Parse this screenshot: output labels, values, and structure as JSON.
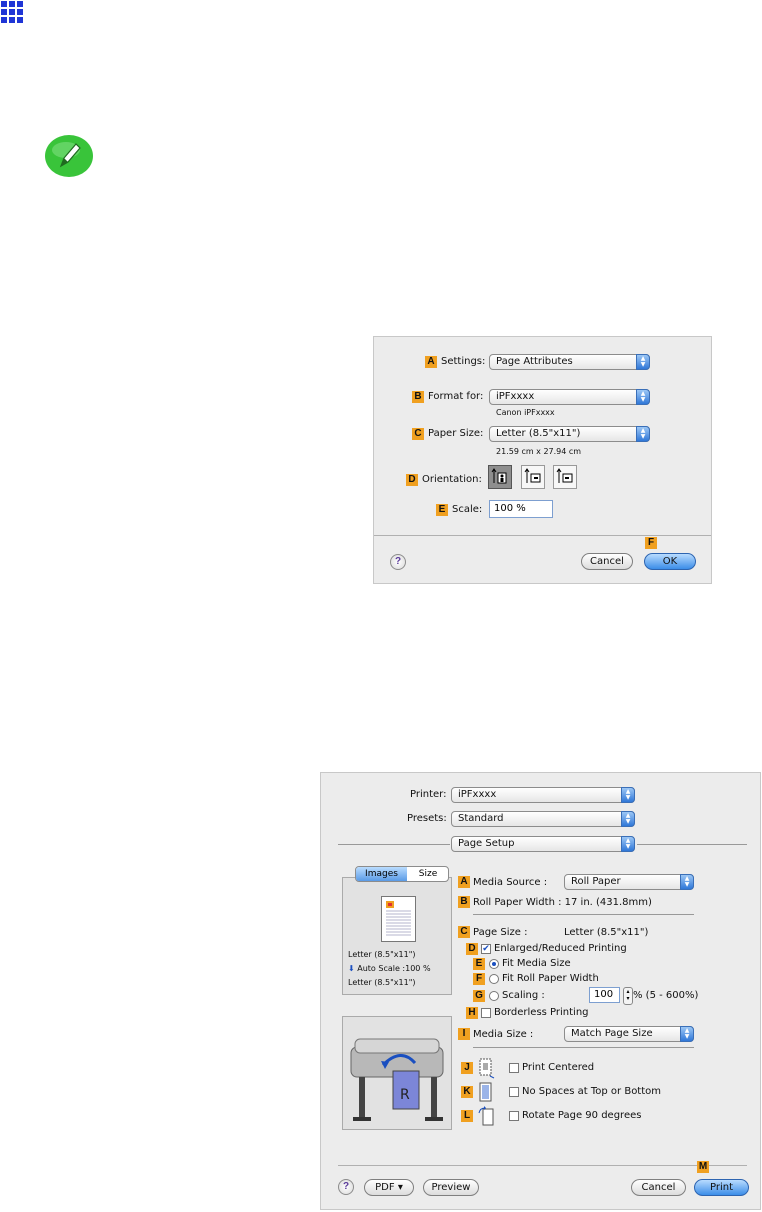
{
  "page_icon": "grid-icon",
  "note_icon": "pencil-note-icon",
  "page_setup_dialog": {
    "settings_label": "Settings:",
    "settings_value": "Page Attributes",
    "format_for_label": "Format for:",
    "format_for_value": "iPFxxxx",
    "format_for_sub": "Canon iPFxxxx",
    "paper_size_label": "Paper Size:",
    "paper_size_value": "Letter (8.5\"x11\")",
    "paper_size_sub": "21.59 cm x 27.94 cm",
    "orientation_label": "Orientation:",
    "scale_label": "Scale:",
    "scale_value": "100 %",
    "help": "?",
    "cancel": "Cancel",
    "ok": "OK",
    "badges": {
      "a": "A",
      "b": "B",
      "c": "C",
      "d": "D",
      "e": "E",
      "f": "F"
    }
  },
  "print_dialog": {
    "printer_label": "Printer:",
    "printer_value": "iPFxxxx",
    "presets_label": "Presets:",
    "presets_value": "Standard",
    "panel_value": "Page Setup",
    "tabs": [
      "Images",
      "Size"
    ],
    "preview_text": [
      "Letter (8.5\"x11\")",
      "Auto Scale :100 %",
      "Letter (8.5\"x11\")"
    ],
    "media_source_label": "Media Source :",
    "media_source_value": "Roll Paper",
    "roll_width": "Roll Paper Width : 17 in. (431.8mm)",
    "page_size_label": "Page Size :",
    "page_size_value": "Letter (8.5\"x11\")",
    "enlarged_label": "Enlarged/Reduced Printing",
    "fit_media_label": "Fit Media Size",
    "fit_roll_label": "Fit Roll Paper Width",
    "scaling_label": "Scaling :",
    "scaling_value": "100",
    "scaling_range": "% (5 - 600%)",
    "borderless_label": "Borderless Printing",
    "media_size_label": "Media Size :",
    "media_size_value": "Match Page Size",
    "print_centered_label": "Print Centered",
    "no_spaces_label": "No Spaces at Top or Bottom",
    "rotate_label": "Rotate Page 90 degrees",
    "help": "?",
    "pdf": "PDF ▾",
    "preview": "Preview",
    "cancel": "Cancel",
    "print": "Print",
    "badges": {
      "a": "A",
      "b": "B",
      "c": "C",
      "d": "D",
      "e": "E",
      "f": "F",
      "g": "G",
      "h": "H",
      "i": "I",
      "j": "J",
      "k": "K",
      "l": "L",
      "m": "M"
    }
  }
}
